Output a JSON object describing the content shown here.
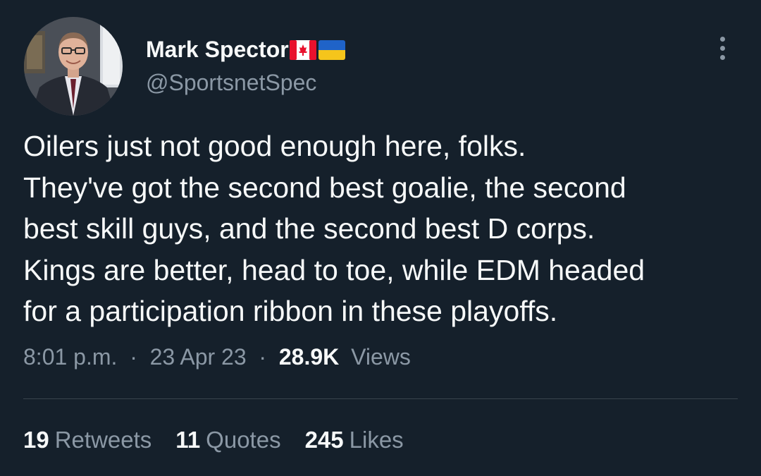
{
  "author": {
    "name": "Mark Spector",
    "handle": "@SportsnetSpec",
    "flags": [
      "canada-flag-icon",
      "ukraine-flag-icon"
    ]
  },
  "tweet": {
    "lines": [
      "Oilers just not good enough here, folks.",
      "They've got the second best goalie, the second",
      "best skill guys, and the second best D corps.",
      "Kings are better, head to toe, while EDM headed",
      "for a participation ribbon in these playoffs."
    ]
  },
  "meta": {
    "time": "8:01 p.m.",
    "separator": "·",
    "date": "23 Apr 23",
    "views_count": "28.9K",
    "views_label": "Views"
  },
  "stats": {
    "retweets_count": "19",
    "retweets_label": "Retweets",
    "quotes_count": "11",
    "quotes_label": "Quotes",
    "likes_count": "245",
    "likes_label": "Likes"
  },
  "colors": {
    "background": "#15202b",
    "text_primary": "#f7f9f9",
    "text_secondary": "#8b98a5",
    "divider": "#38444d"
  },
  "icons": {
    "more": "more-options-icon"
  }
}
